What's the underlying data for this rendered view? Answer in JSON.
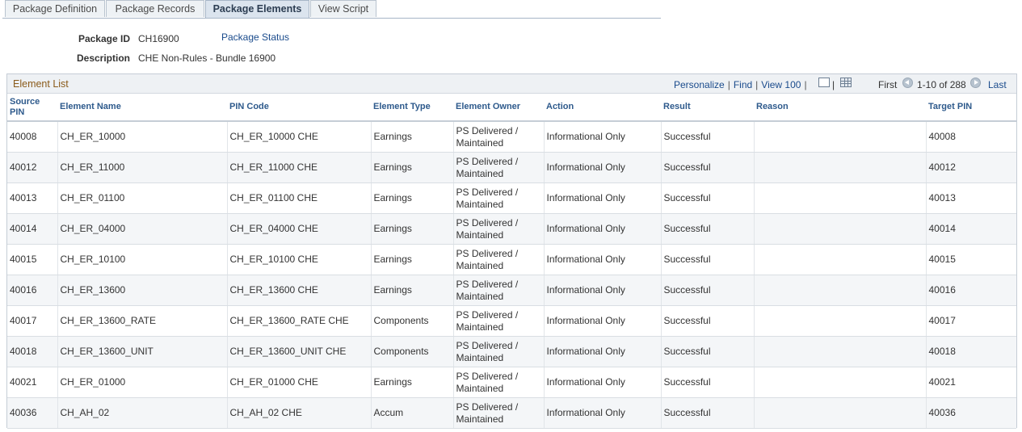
{
  "tabs": [
    {
      "label": "Package Definition",
      "active": false
    },
    {
      "label": "Package Records",
      "active": false
    },
    {
      "label": "Package Elements",
      "active": true
    },
    {
      "label": "View Script",
      "active": false
    }
  ],
  "header": {
    "package_id_label": "Package ID",
    "package_id": "CH16900",
    "package_status_link": "Package Status",
    "description_label": "Description",
    "description": "CHE Non-Rules - Bundle 16900"
  },
  "grid": {
    "title": "Element List",
    "personalize": "Personalize",
    "find": "Find",
    "view_all": "View 100",
    "first": "First",
    "range": "1-10 of 288",
    "last": "Last",
    "columns": [
      "Source PIN",
      "Element Name",
      "PIN Code",
      "Element Type",
      "Element Owner",
      "Action",
      "Result",
      "Reason",
      "Target PIN"
    ],
    "rows": [
      [
        "40008",
        "CH_ER_10000",
        "CH_ER_10000 CHE",
        "Earnings",
        "PS Delivered / Maintained",
        "Informational Only",
        "Successful",
        "",
        "40008"
      ],
      [
        "40012",
        "CH_ER_11000",
        "CH_ER_11000 CHE",
        "Earnings",
        "PS Delivered / Maintained",
        "Informational Only",
        "Successful",
        "",
        "40012"
      ],
      [
        "40013",
        "CH_ER_01100",
        "CH_ER_01100 CHE",
        "Earnings",
        "PS Delivered / Maintained",
        "Informational Only",
        "Successful",
        "",
        "40013"
      ],
      [
        "40014",
        "CH_ER_04000",
        "CH_ER_04000 CHE",
        "Earnings",
        "PS Delivered / Maintained",
        "Informational Only",
        "Successful",
        "",
        "40014"
      ],
      [
        "40015",
        "CH_ER_10100",
        "CH_ER_10100 CHE",
        "Earnings",
        "PS Delivered / Maintained",
        "Informational Only",
        "Successful",
        "",
        "40015"
      ],
      [
        "40016",
        "CH_ER_13600",
        "CH_ER_13600 CHE",
        "Earnings",
        "PS Delivered / Maintained",
        "Informational Only",
        "Successful",
        "",
        "40016"
      ],
      [
        "40017",
        "CH_ER_13600_RATE",
        "CH_ER_13600_RATE CHE",
        "Components",
        "PS Delivered / Maintained",
        "Informational Only",
        "Successful",
        "",
        "40017"
      ],
      [
        "40018",
        "CH_ER_13600_UNIT",
        "CH_ER_13600_UNIT CHE",
        "Components",
        "PS Delivered / Maintained",
        "Informational Only",
        "Successful",
        "",
        "40018"
      ],
      [
        "40021",
        "CH_ER_01000",
        "CH_ER_01000 CHE",
        "Earnings",
        "PS Delivered / Maintained",
        "Informational Only",
        "Successful",
        "",
        "40021"
      ],
      [
        "40036",
        "CH_AH_02",
        "CH_AH_02 CHE",
        "Accum",
        "PS Delivered / Maintained",
        "Informational Only",
        "Successful",
        "",
        "40036"
      ]
    ]
  }
}
